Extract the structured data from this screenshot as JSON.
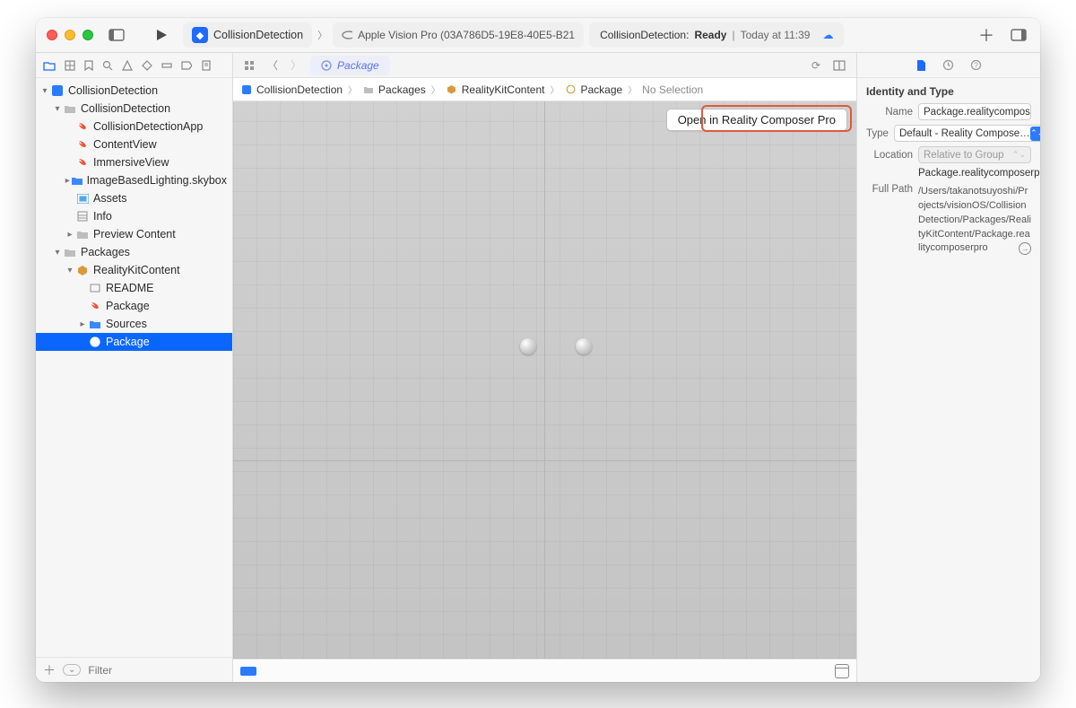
{
  "title": {
    "project": "CollisionDetection",
    "device": "Apple Vision Pro (03A786D5-19E8-40E5-B21",
    "status_project": "CollisionDetection:",
    "status_state": "Ready",
    "status_time": "Today at 11:39"
  },
  "tab": {
    "name": "Package"
  },
  "crumbs": {
    "c0": "CollisionDetection",
    "c1": "Packages",
    "c2": "RealityKitContent",
    "c3": "Package",
    "c4": "No Selection"
  },
  "open_button": "Open in Reality Composer Pro",
  "navigator": {
    "filter_placeholder": "Filter",
    "items": {
      "root": "CollisionDetection",
      "app_folder": "CollisionDetection",
      "app_swift": "CollisionDetectionApp",
      "contentview": "ContentView",
      "immersive": "ImmersiveView",
      "skybox": "ImageBasedLighting.skybox",
      "assets": "Assets",
      "info": "Info",
      "preview": "Preview Content",
      "packages": "Packages",
      "rkc": "RealityKitContent",
      "readme": "README",
      "package_swift": "Package",
      "sources": "Sources",
      "package_rcp": "Package"
    }
  },
  "inspector": {
    "section": "Identity and Type",
    "name_label": "Name",
    "name_value": "Package.realitycomposerpro",
    "type_label": "Type",
    "type_value": "Default - Reality Compose…",
    "location_label": "Location",
    "location_value": "Relative to Group",
    "location_file": "Package.realitycomposerpro",
    "fullpath_label": "Full Path",
    "fullpath_value": "/Users/takanotsuyoshi/Projects/visionOS/CollisionDetection/Packages/RealityKitContent/Package.realitycomposerpro"
  }
}
